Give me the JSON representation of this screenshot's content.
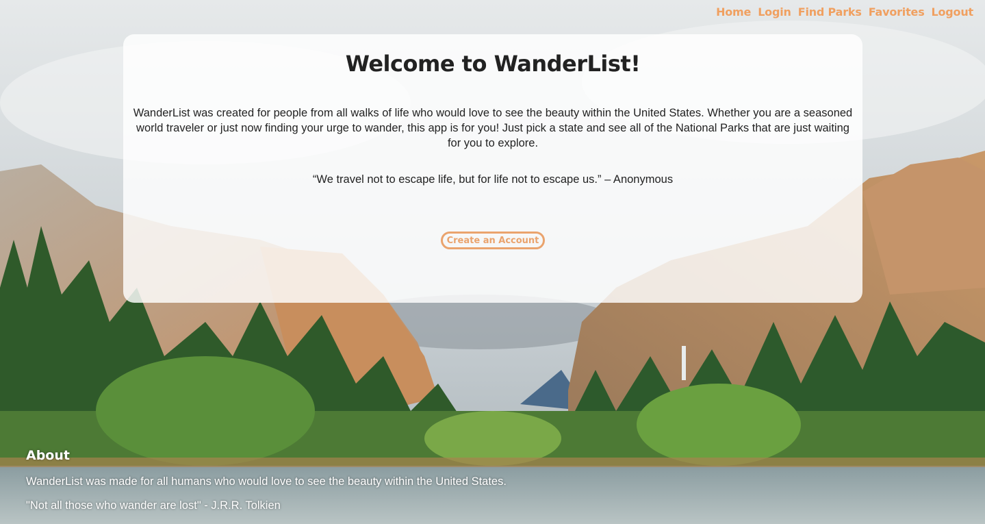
{
  "nav": {
    "items": [
      "Home",
      "Login",
      "Find Parks",
      "Favorites",
      "Logout"
    ]
  },
  "card": {
    "title": "Welcome to WanderList!",
    "intro": "WanderList was created for people from all walks of life who would love to see the beauty within the United States. Whether you are a seasoned world traveler or just now finding your urge to wander, this app is for you! Just pick a state and see all of the National Parks that are just waiting for you to explore.",
    "quote": "“We travel not to escape life, but for life not to escape us.” – Anonymous",
    "cta_label": "Create an Account"
  },
  "footer": {
    "heading": "About",
    "line1": "WanderList was made for all humans who would love to see the beauty within the United States.",
    "line2": "\"Not all those who wander are lost\" - J.R.R. Tolkien"
  },
  "colors": {
    "accent": "#f0a060",
    "card_bg": "rgba(255,255,255,0.82)"
  }
}
